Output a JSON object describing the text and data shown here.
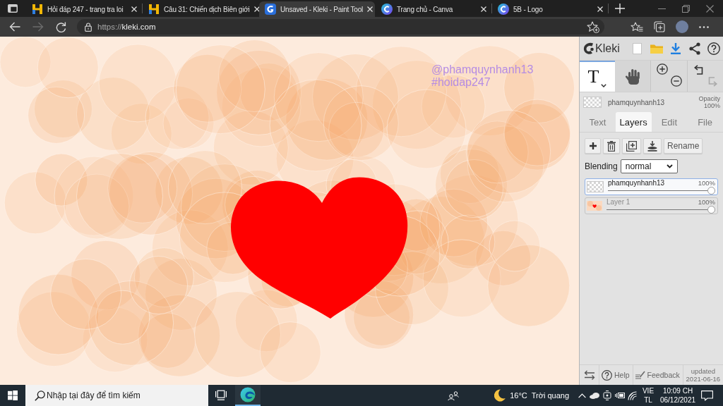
{
  "browser": {
    "tabs": [
      {
        "kind": "hoidap",
        "title": "Hỏi đáp 247 - trang tra loi",
        "selected": false
      },
      {
        "kind": "hoidap",
        "title": "Câu 31: Chiến dịch Biên giới",
        "selected": false
      },
      {
        "kind": "kleki",
        "title": "Unsaved - Kleki - Paint Tool",
        "selected": true
      },
      {
        "kind": "canva",
        "title": "Trang chủ - Canva",
        "selected": false
      },
      {
        "kind": "canva",
        "title": "5B - Logo",
        "selected": false
      }
    ],
    "nav_buttons": [
      {
        "kind": "back",
        "disabled": false
      },
      {
        "kind": "forward",
        "disabled": true
      },
      {
        "kind": "reload",
        "disabled": false
      }
    ],
    "address": {
      "scheme": "https://",
      "host": "kleki.com"
    }
  },
  "canvas": {
    "text_lines": [
      "@phamquynhanh13",
      "#hoidap247"
    ]
  },
  "panel": {
    "logo": "Kleki",
    "tools": [
      {
        "kind": "text",
        "glyph": "T",
        "selected": true
      },
      {
        "kind": "hand",
        "selected": false
      }
    ],
    "history": [
      {
        "kind": "undo",
        "disabled": false
      },
      {
        "kind": "redo",
        "disabled": true
      }
    ],
    "current_layer": {
      "name": "phamquynhanh13",
      "opacity_label": "Opacity",
      "opacity": "100%"
    },
    "tabs": [
      {
        "label": "Text",
        "selected": false
      },
      {
        "label": "Layers",
        "selected": true
      },
      {
        "label": "Edit",
        "selected": false
      },
      {
        "label": "File",
        "selected": false
      }
    ],
    "rename_button": "Rename",
    "blending": {
      "label": "Blending",
      "value": "normal"
    },
    "layers": [
      {
        "kind": "blank",
        "name": "phamquynhanh13",
        "opacity": "100%",
        "level": 1,
        "selected": true
      },
      {
        "kind": "picture",
        "name": "Layer 1",
        "opacity": "100%",
        "level": 1,
        "selected": false
      }
    ],
    "footer": {
      "help": "Help",
      "feedback": "Feedback",
      "updated_label": "updated",
      "updated_date": "2021-06-16"
    }
  },
  "taskbar": {
    "search_placeholder": "Nhập tại đây để tìm kiếm",
    "apps": [
      {
        "kind": "taskview",
        "running": false
      },
      {
        "kind": "browser",
        "running": true
      }
    ],
    "weather": {
      "temperature": "16°C",
      "condition": "Trời quang"
    },
    "language": {
      "code": "VIE",
      "layout": "TL"
    },
    "clock": {
      "time": "10:09 CH",
      "date": "06/12/2021"
    }
  }
}
